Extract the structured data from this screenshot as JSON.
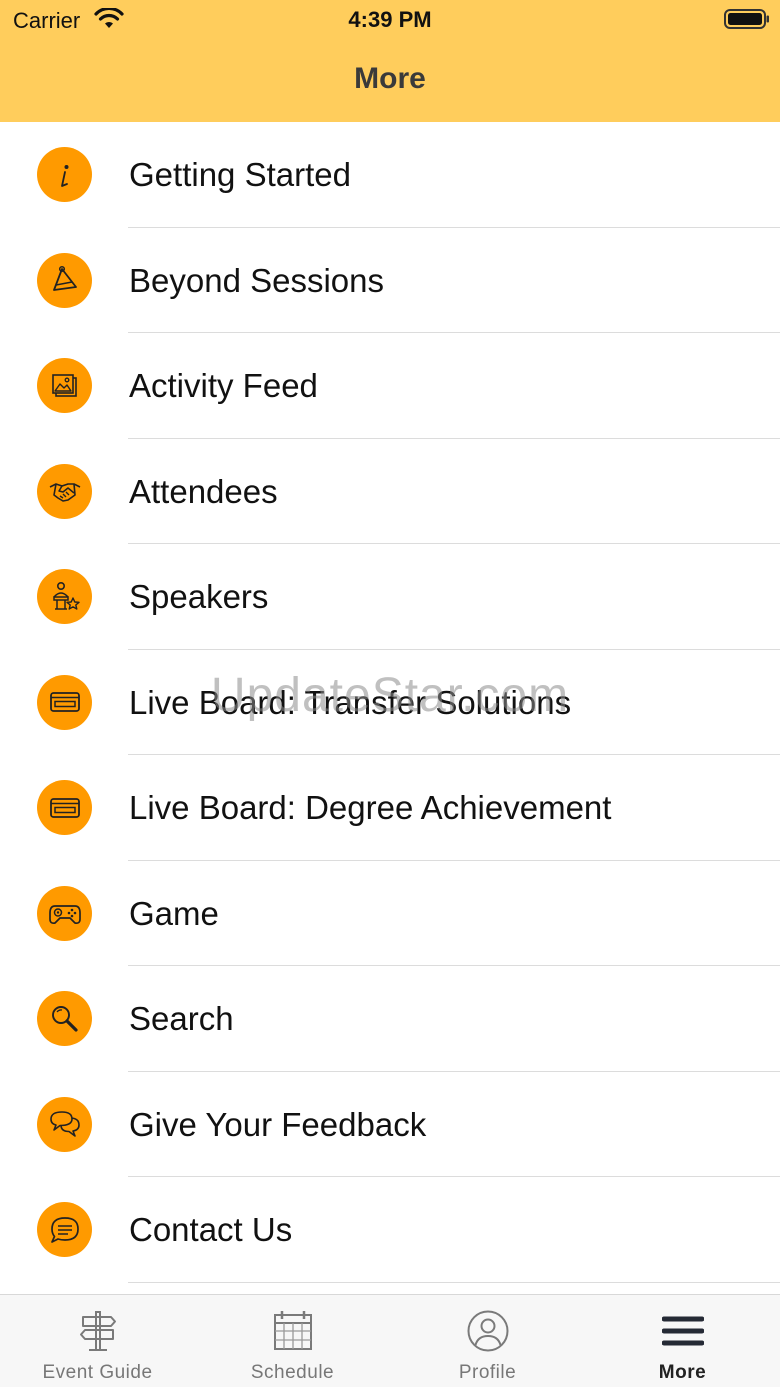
{
  "status_bar": {
    "carrier": "Carrier",
    "time": "4:39 PM"
  },
  "header": {
    "title": "More",
    "background": "#FFCD5C"
  },
  "accent_color": "#FF9A00",
  "menu": [
    {
      "label": "Getting Started",
      "icon": "info-icon"
    },
    {
      "label": "Beyond Sessions",
      "icon": "party-hat-icon"
    },
    {
      "label": "Activity Feed",
      "icon": "photos-icon"
    },
    {
      "label": "Attendees",
      "icon": "handshake-icon"
    },
    {
      "label": "Speakers",
      "icon": "speaker-podium-icon"
    },
    {
      "label": "Live Board: Transfer Solutions",
      "icon": "card-icon"
    },
    {
      "label": "Live Board: Degree Achievement",
      "icon": "card-icon"
    },
    {
      "label": "Game",
      "icon": "gamepad-icon"
    },
    {
      "label": "Search",
      "icon": "search-icon"
    },
    {
      "label": "Give Your Feedback",
      "icon": "chat-bubbles-icon"
    },
    {
      "label": "Contact Us",
      "icon": "message-icon"
    }
  ],
  "watermark": "UpdateStar.com",
  "tabs": [
    {
      "label": "Event Guide",
      "icon": "signpost-icon",
      "active": false
    },
    {
      "label": "Schedule",
      "icon": "calendar-icon",
      "active": false
    },
    {
      "label": "Profile",
      "icon": "profile-icon",
      "active": false
    },
    {
      "label": "More",
      "icon": "menu-icon",
      "active": true
    }
  ]
}
